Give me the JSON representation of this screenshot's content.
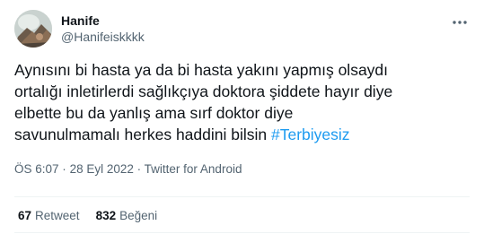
{
  "author": {
    "display_name": "Hanife",
    "handle": "@Hanifeiskkkk"
  },
  "tweet": {
    "lines": [
      "Aynısını bi hasta ya da bi hasta yakını yapmış olsaydı",
      "ortalığı inletirlerdi sağlıkçıya doktora şiddete hayır diye",
      "elbette bu da yanlış ama sırf doktor diye"
    ],
    "last_line_text": "savunulmamalı herkes haddini bilsin",
    "hashtag": "#Terbiyesiz"
  },
  "meta": {
    "time": "ÖS 6:07",
    "separator": "·",
    "date": "28 Eyl 2022",
    "source": "Twitter for Android"
  },
  "stats": {
    "retweets_count": "67",
    "retweets_label": "Retweet",
    "likes_count": "832",
    "likes_label": "Beğeni"
  },
  "icons": {
    "more": "more-dots-icon"
  },
  "colors": {
    "text": "#0f1419",
    "secondary": "#536471",
    "link": "#1d9bf0",
    "divider": "#eff3f4"
  }
}
